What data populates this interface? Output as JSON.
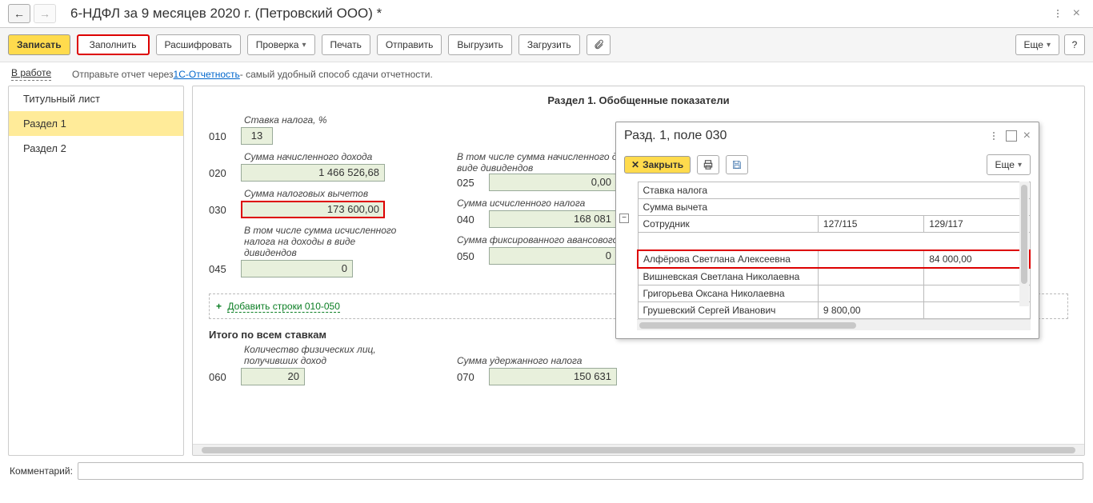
{
  "header": {
    "title": "6-НДФЛ за 9 месяцев 2020 г. (Петровский ООО) *"
  },
  "toolbar": {
    "save": "Записать",
    "fill": "Заполнить",
    "decode": "Расшифровать",
    "check": "Проверка",
    "print": "Печать",
    "send": "Отправить",
    "export": "Выгрузить",
    "import": "Загрузить",
    "more": "Еще",
    "help": "?"
  },
  "status": {
    "in_work": "В работе",
    "hint_prefix": "Отправьте отчет через ",
    "hint_link": "1С-Отчетность",
    "hint_suffix": " - самый удобный способ сдачи отчетности."
  },
  "sidebar": {
    "items": [
      {
        "label": "Титульный лист"
      },
      {
        "label": "Раздел 1"
      },
      {
        "label": "Раздел 2"
      }
    ]
  },
  "section": {
    "title": "Раздел 1. Обобщенные показатели",
    "rate_label": "Ставка налога, %",
    "l010": {
      "code": "010",
      "value": "13"
    },
    "l020": {
      "code": "020",
      "label": "Сумма начисленного дохода",
      "value": "1 466 526,68"
    },
    "l025": {
      "code": "025",
      "label": "В том числе сумма начисленного дохода в виде дивидендов",
      "value": "0,00"
    },
    "l030": {
      "code": "030",
      "label": "Сумма налоговых вычетов",
      "value": "173 600,00"
    },
    "l040": {
      "code": "040",
      "label": "Сумма исчисленного налога",
      "value": "168 081"
    },
    "l045": {
      "code": "045",
      "label": "В том числе сумма исчисленного налога на доходы в виде дивидендов",
      "value": "0"
    },
    "l050": {
      "code": "050",
      "label": "Сумма фиксированного авансового платежа",
      "value": "0"
    },
    "add_lines": "Добавить строки 010-050",
    "total_label": "Итого по всем ставкам",
    "l060": {
      "code": "060",
      "label": "Количество физических лиц, получивших доход",
      "value": "20"
    },
    "l070": {
      "code": "070",
      "label": "Сумма удержанного налога",
      "value": "150 631"
    }
  },
  "popup": {
    "title": "Разд. 1, поле 030",
    "close": "Закрыть",
    "more": "Еще",
    "head_rate": "Ставка налога",
    "head_sum": "Сумма вычета",
    "col_emp": "Сотрудник",
    "col_a": "127/115",
    "col_b": "129/117",
    "rows": [
      {
        "name": "Алфёрова Светлана Алексеевна",
        "a": "",
        "b": "84 000,00"
      },
      {
        "name": "Вишневская Светлана Николаевна",
        "a": "",
        "b": ""
      },
      {
        "name": "Григорьева Оксана Николаевна",
        "a": "",
        "b": ""
      },
      {
        "name": "Грушевский Сергей Иванович",
        "a": "9 800,00",
        "b": ""
      }
    ]
  },
  "comment": {
    "label": "Комментарий:"
  }
}
